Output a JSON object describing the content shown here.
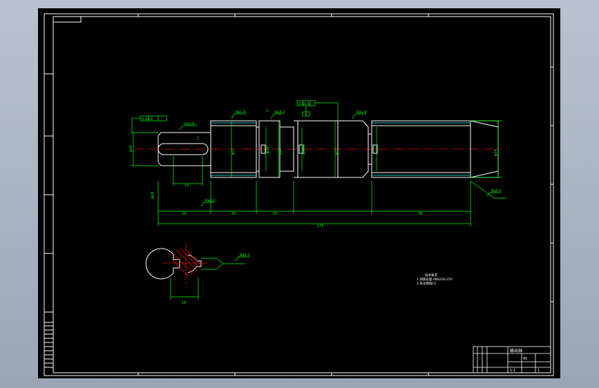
{
  "drawing": {
    "overall_length": "175",
    "key_width": "15",
    "key_depth": "16",
    "section_width": "18",
    "d_left_end": "φ24",
    "d_bearing_left": "φ27",
    "d_shoulder_left": "φ30",
    "d_gear_seat": "φ32",
    "d_collar": "φ38.8",
    "d_shoulder_right": "φ27",
    "d_right_end": "φ24",
    "seg_24": "24",
    "seg_25": "25",
    "seg_10": "10",
    "seg_58": "58",
    "dim_2": "2",
    "dim_3": "3",
    "dim_left_chamfer": "φ24",
    "dim_vertical_left": "φ24",
    "roughness_1": "Ra1.6",
    "roughness_2": "Ra1.6",
    "roughness_3": "Ra3.2",
    "roughness_4": "Ra1.6",
    "roughness_5": "Ra3.2",
    "roughness_6": "Ra3.2",
    "roughness_section": "Ra3.2",
    "tolerance_left": "0.01 A",
    "tolerance_mid": "0.01 A",
    "datum": "A",
    "notes_title": "技术要求",
    "notes_line1": "1.调质处理 HBS220-250",
    "notes_line2": "2.未注倒角C1"
  },
  "title_block": {
    "name": "输出轴",
    "material": "45",
    "scale": "1:1",
    "sheet": "1"
  },
  "colors": {
    "background": "#000000",
    "frame": "#ffffff",
    "part": "#ffffff",
    "dimension": "#00ff00",
    "centerline": "#ff0000",
    "hatch": "#ff0000",
    "hidden": "#00ffff"
  }
}
